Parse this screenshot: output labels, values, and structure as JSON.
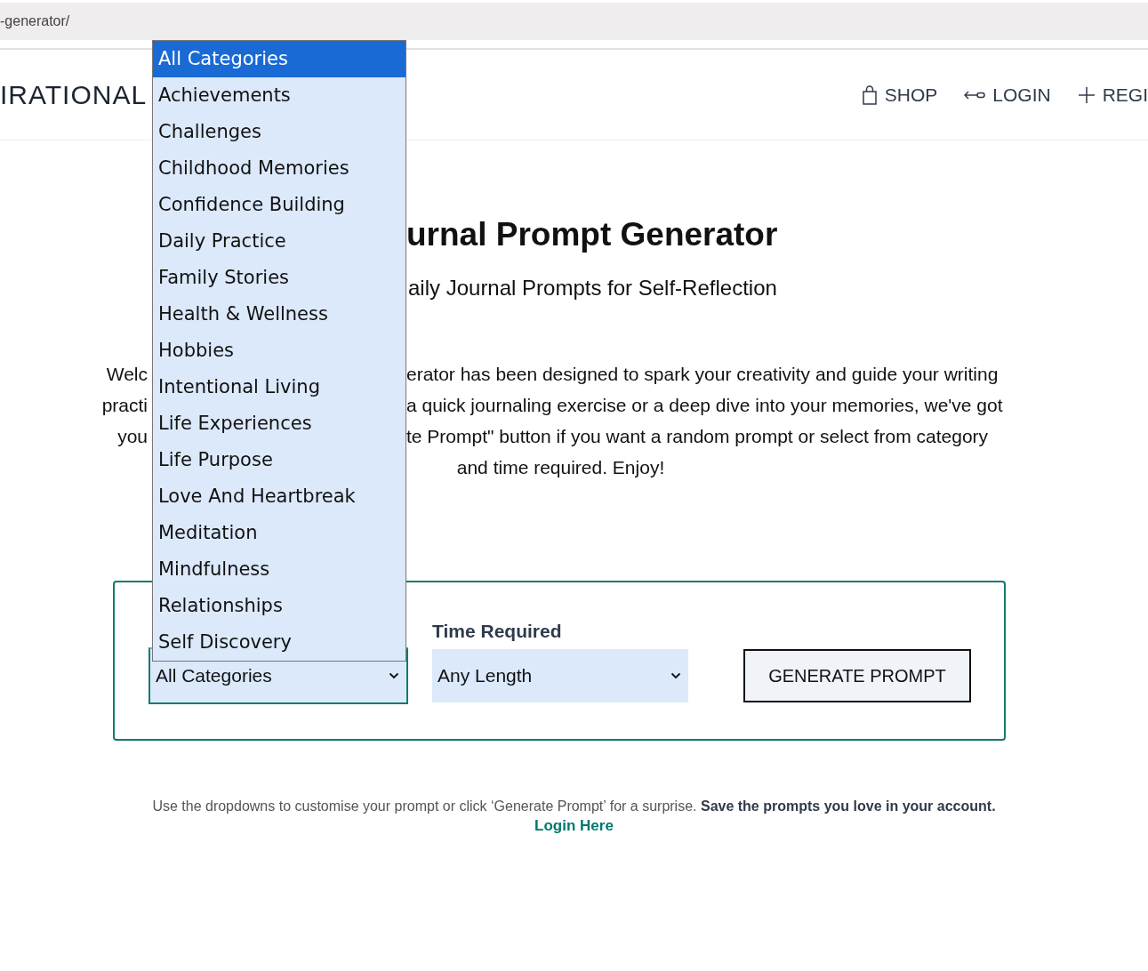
{
  "browser": {
    "address": "-generator/"
  },
  "header": {
    "logo": "IRATIONAL",
    "nav": [
      {
        "label": "SHOP",
        "kind": "shop"
      },
      {
        "label": "LOGIN",
        "kind": "login"
      },
      {
        "label": "REGI",
        "kind": "register"
      }
    ]
  },
  "hero": {
    "title": "urnal Prompt Generator",
    "subtitle": "aily Journal Prompts for Self-Reflection"
  },
  "intro": {
    "lines": [
      {
        "kind": "split",
        "left": "Welc",
        "right": "erator has been designed to spark your creativity and guide your writing"
      },
      {
        "kind": "split",
        "left": "practi",
        "right": "a quick journaling exercise or a deep dive into your memories, we've got"
      },
      {
        "kind": "split",
        "left": "you",
        "right": "te Prompt\" button if you want a random prompt or select from category"
      },
      {
        "kind": "full",
        "text": "and time required. Enjoy!"
      }
    ]
  },
  "form": {
    "category": {
      "value": "All Categories",
      "options": [
        {
          "label": "All Categories",
          "selected": true
        },
        {
          "label": "Achievements",
          "selected": false
        },
        {
          "label": "Challenges",
          "selected": false
        },
        {
          "label": "Childhood Memories",
          "selected": false
        },
        {
          "label": "Confidence Building",
          "selected": false
        },
        {
          "label": "Daily Practice",
          "selected": false
        },
        {
          "label": "Family Stories",
          "selected": false
        },
        {
          "label": "Health & Wellness",
          "selected": false
        },
        {
          "label": "Hobbies",
          "selected": false
        },
        {
          "label": "Intentional Living",
          "selected": false
        },
        {
          "label": "Life Experiences",
          "selected": false
        },
        {
          "label": "Life Purpose",
          "selected": false
        },
        {
          "label": "Love And Heartbreak",
          "selected": false
        },
        {
          "label": "Meditation",
          "selected": false
        },
        {
          "label": "Mindfulness",
          "selected": false
        },
        {
          "label": "Relationships",
          "selected": false
        },
        {
          "label": "Self Discovery",
          "selected": false
        }
      ]
    },
    "time": {
      "label": "Time Required",
      "value": "Any Length"
    },
    "button": "GENERATE PROMPT"
  },
  "footer": {
    "text": "Use the dropdowns to customise your prompt or click ‘Generate Prompt’ for a surprise. **Save the prompts you love in your account.**",
    "link": "Login Here"
  }
}
